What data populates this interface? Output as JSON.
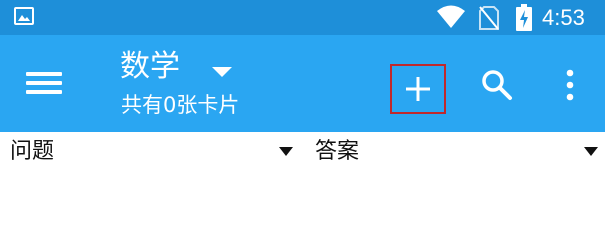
{
  "status_bar": {
    "time": "4:53",
    "icons": [
      "gallery-icon",
      "wifi-icon",
      "no-sim-icon",
      "battery-charging-icon"
    ]
  },
  "toolbar": {
    "deck_title": "数学",
    "card_count_text": "共有0张卡片",
    "icons": [
      "hamburger-menu-icon",
      "dropdown-arrow-icon",
      "plus-icon",
      "search-icon",
      "more-vert-icon"
    ]
  },
  "columns": [
    {
      "label": "问题",
      "icon": "dropdown-arrow-icon"
    },
    {
      "label": "答案",
      "icon": "dropdown-arrow-icon"
    }
  ],
  "colors": {
    "status_bar": "#1e8fd9",
    "toolbar": "#2aa6f2",
    "highlight_border": "#c0282c",
    "text_dark": "#111111",
    "background": "#ffffff"
  }
}
